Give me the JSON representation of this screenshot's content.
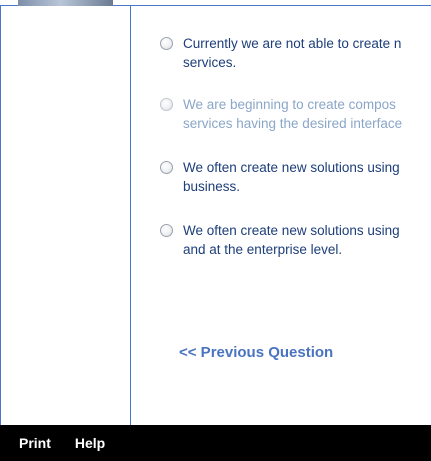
{
  "options": [
    {
      "line1": "Currently we are not able to create n",
      "line2": "services."
    },
    {
      "line1": "We are beginning to create compos",
      "line2": "services having the desired interface"
    },
    {
      "line1": "We often create new solutions using",
      "line2": "business."
    },
    {
      "line1": "We often create new solutions using",
      "line2": "and at the enterprise level."
    }
  ],
  "navigation": {
    "previous_label": "<< Previous Question"
  },
  "footer": {
    "print_label": "Print",
    "help_label": "Help"
  }
}
